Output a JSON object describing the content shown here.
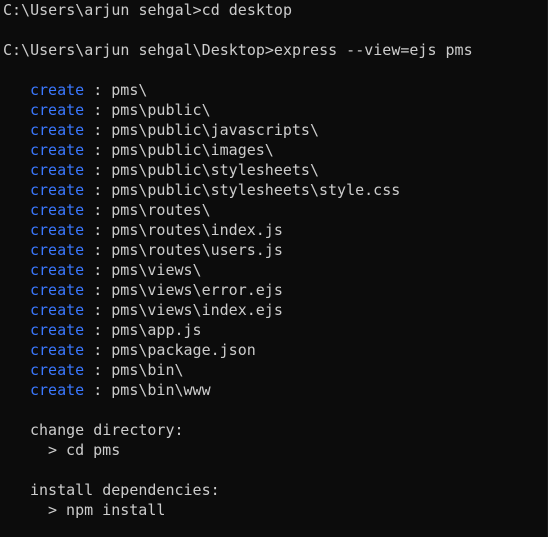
{
  "terminal": {
    "prompt1": "C:\\Users\\arjun sehgal>cd desktop",
    "prompt2": "C:\\Users\\arjun sehgal\\Desktop>express --view=ejs pms",
    "create_label": "create",
    "separator": " : ",
    "created_paths": [
      "pms\\",
      "pms\\public\\",
      "pms\\public\\javascripts\\",
      "pms\\public\\images\\",
      "pms\\public\\stylesheets\\",
      "pms\\public\\stylesheets\\style.css",
      "pms\\routes\\",
      "pms\\routes\\index.js",
      "pms\\routes\\users.js",
      "pms\\views\\",
      "pms\\views\\error.ejs",
      "pms\\views\\index.ejs",
      "pms\\app.js",
      "pms\\package.json",
      "pms\\bin\\",
      "pms\\bin\\www"
    ],
    "change_dir_heading": "change directory:",
    "change_dir_cmd": "> cd pms",
    "install_heading": "install dependencies:",
    "install_cmd": "> npm install"
  },
  "colors": {
    "background": "#0c0c0c",
    "text": "#cccccc",
    "create_keyword": "#3b78ff"
  }
}
